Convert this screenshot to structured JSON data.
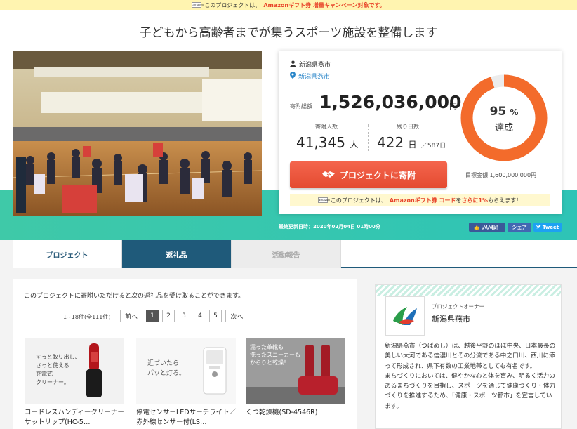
{
  "banner": {
    "logo_text": "amazon",
    "before": "このプロジェクトは、",
    "highlight": "Amazonギフト券 増量キャンペーン対象です。"
  },
  "project": {
    "title": "子どもから高齢者までが集うスポーツ施設を整備します",
    "owner": "新潟県燕市",
    "location": "新潟県燕市"
  },
  "stats": {
    "amount_label": "寄附総額",
    "amount": "1,526,036,000",
    "amount_unit": "円",
    "donors_label": "寄附人数",
    "donors": "41,345",
    "donors_unit": "人",
    "days_label": "残り日数",
    "days": "422",
    "days_unit": "日",
    "days_total": "／587日",
    "percent": "95",
    "percent_sign": "%",
    "percent_value": 0.95,
    "achieved_label": "達成",
    "goal": "目標金額 1,600,000,000円",
    "donate_button": "プロジェクトに寄附"
  },
  "gift_strip": {
    "before": "このプロジェクトは、",
    "highlight": "Amazonギフト券 コード",
    "middle": "を",
    "highlight2": "さらに1%",
    "after": "もらえます！"
  },
  "updated": "最終更新日時：2020年02月04日 01時00分",
  "social": {
    "like": "いいね！",
    "share": "シェア",
    "tweet": "Tweet"
  },
  "tabs": [
    "プロジェクト",
    "返礼品",
    "活動報告"
  ],
  "rewards": {
    "intro": "このプロジェクトに寄附いただけると次の返礼品を受け取ることができます。",
    "count": "1~18件(全111件)",
    "pager": {
      "prev": "前へ",
      "pages": [
        "1",
        "2",
        "3",
        "4",
        "5"
      ],
      "next": "次へ"
    },
    "items": [
      {
        "caption": "すっと取り出し、\nさっと使える\n充電式\nクリーナー。",
        "name": "コードレスハンディークリーナー サットリップ(HC-5…"
      },
      {
        "caption": "近づいたら\nパッと灯る。",
        "name": "停電センサーLEDサーチライト／赤外線センサー付(LS…"
      },
      {
        "caption": "濡った革靴も\n洗ったスニーカーも\nからりと乾燥！",
        "name": "くつ乾燥機(SD-4546R)"
      }
    ]
  },
  "owner_panel": {
    "role": "プロジェクトオーナー",
    "name": "新潟県燕市",
    "description": "新潟県燕市（つばめし）は、越後平野のほぼ中央、日本最長の美しい大河である信濃川とその分流である中之口川、西川に添って形成され、県下有数の工業地帯としても有名です。\nまちづくりにおいては、健やかな心と体を育み、明るく活力のあるまちづくりを目指し、スポーツを通じて健康づくり・体力づくりを推進するため、「健康・スポーツ都市」を宣言しています。"
  },
  "colors": {
    "accent": "#e8442a",
    "teal": "#3fc9a8",
    "navy": "#1f5a7a",
    "donut": "#f36b2b"
  }
}
